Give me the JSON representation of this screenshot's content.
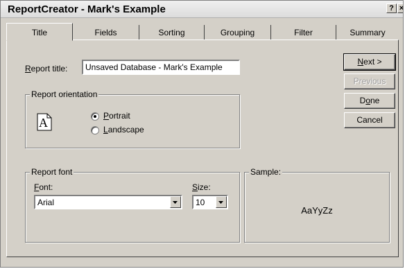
{
  "window": {
    "title": "ReportCreator - Mark's Example",
    "help_glyph": "?",
    "close_glyph": "×"
  },
  "tabs": [
    {
      "label": "Title",
      "active": true
    },
    {
      "label": "Fields",
      "active": false
    },
    {
      "label": "Sorting",
      "active": false
    },
    {
      "label": "Grouping",
      "active": false
    },
    {
      "label": "Filter",
      "active": false
    },
    {
      "label": "Summary",
      "active": false
    }
  ],
  "report_title": {
    "label_hotkey": "R",
    "label_rest": "eport title:",
    "value": "Unsaved Database  - Mark's Example"
  },
  "orientation": {
    "legend": "Report orientation",
    "icon_letter": "A",
    "portrait_hotkey": "P",
    "portrait_rest": "ortrait",
    "landscape_hotkey": "L",
    "landscape_rest": "andscape",
    "selected": "portrait"
  },
  "font_group": {
    "legend": "Report font",
    "font_label_hotkey": "F",
    "font_label_rest": "ont:",
    "font_value": "Arial",
    "size_label_hotkey": "S",
    "size_label_rest": "ize:",
    "size_value": "10"
  },
  "sample": {
    "legend": "Sample:",
    "text": "AaYyZz"
  },
  "buttons": {
    "next_hotkey": "N",
    "next_rest": "ext >",
    "previous": "Previous",
    "done_hotkey": "o",
    "done_pre": "D",
    "done_rest": "ne",
    "cancel": "Cancel"
  }
}
